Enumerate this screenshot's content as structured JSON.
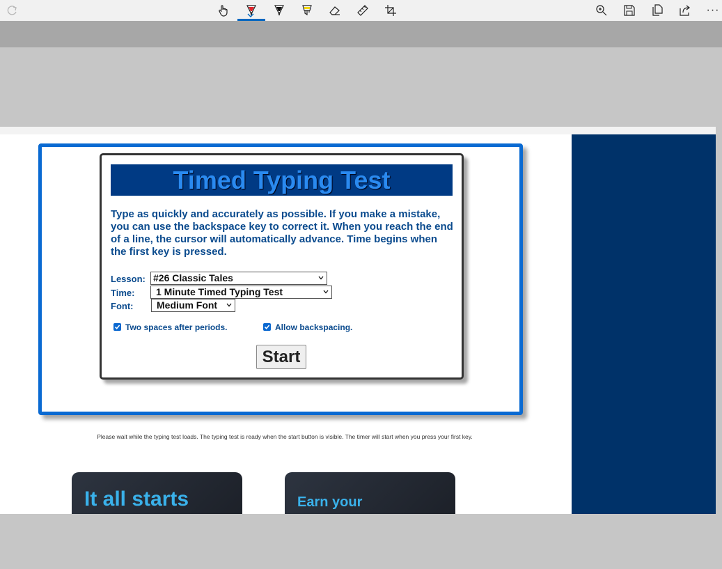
{
  "toolbar": {
    "icons": [
      "redo-icon",
      "touch-writing-icon",
      "ballpoint-pen-icon",
      "pencil-icon",
      "highlighter-icon",
      "eraser-icon",
      "ruler-icon",
      "crop-icon",
      "zoom-icon",
      "save-icon",
      "copy-icon",
      "share-icon",
      "more-icon"
    ],
    "more_label": "···"
  },
  "test": {
    "title": "Timed Typing Test",
    "description": "Type as quickly and accurately as possible. If you make a mistake, you can use the backspace key to correct it. When you reach the end of a line, the cursor will automatically advance. Time begins when the first key is pressed.",
    "lesson_label": "Lesson:",
    "lesson_value": "#26 Classic Tales",
    "time_label": "Time:",
    "time_value": "1 Minute Timed Typing Test",
    "font_label": "Font:",
    "font_value": "Medium Font",
    "two_spaces_label": "Two spaces after periods.",
    "allow_backspace_label": "Allow backspacing.",
    "start_label": "Start"
  },
  "loading_note": "Please wait while the typing test loads. The typing test is ready when the start button is visible. The timer will start when you press your first key.",
  "promos": [
    {
      "text": "It all starts"
    },
    {
      "text": "Earn your"
    }
  ],
  "colors": {
    "accent_blue": "#0a6ad2",
    "title_bar": "#003a84",
    "sidebar_navy": "#003269",
    "promo_text": "#3ab1ea"
  }
}
